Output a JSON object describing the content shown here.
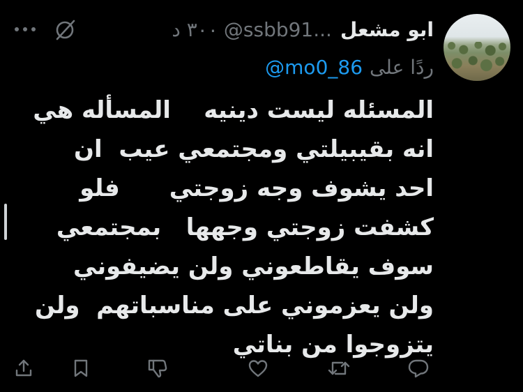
{
  "tweet": {
    "display_name": "ابو مشعل",
    "handle": "@ssbb91...",
    "time": "٣٠٠ د",
    "reply_prefix": "ردًا على",
    "reply_handle": "@mo0_86",
    "body": "المسئله ليست دينيه    المسأله هي\nانه بقيبيلتي ومجتمعي عيب  ان\nاحد يشوف وجه زوجتي      فلو\nكشفت زوجتي وجهها   بمجتمعي\nسوف يقاطعوني ولن يضيفوني\nولن يعزموني على مناسباتهم  ولن\nيتزوجوا من بناتي"
  },
  "icons": {
    "avatar": "landscape-avatar",
    "grok": "grok-icon",
    "more": "more-icon",
    "share": "share-icon",
    "bookmark": "bookmark-icon",
    "dislike": "thumbs-down-icon",
    "like": "heart-icon",
    "retweet": "retweet-icon",
    "reply": "reply-icon"
  },
  "colors": {
    "background": "#000000",
    "text": "#e7e9ea",
    "secondary": "#71767b",
    "link": "#1d9bf0"
  }
}
